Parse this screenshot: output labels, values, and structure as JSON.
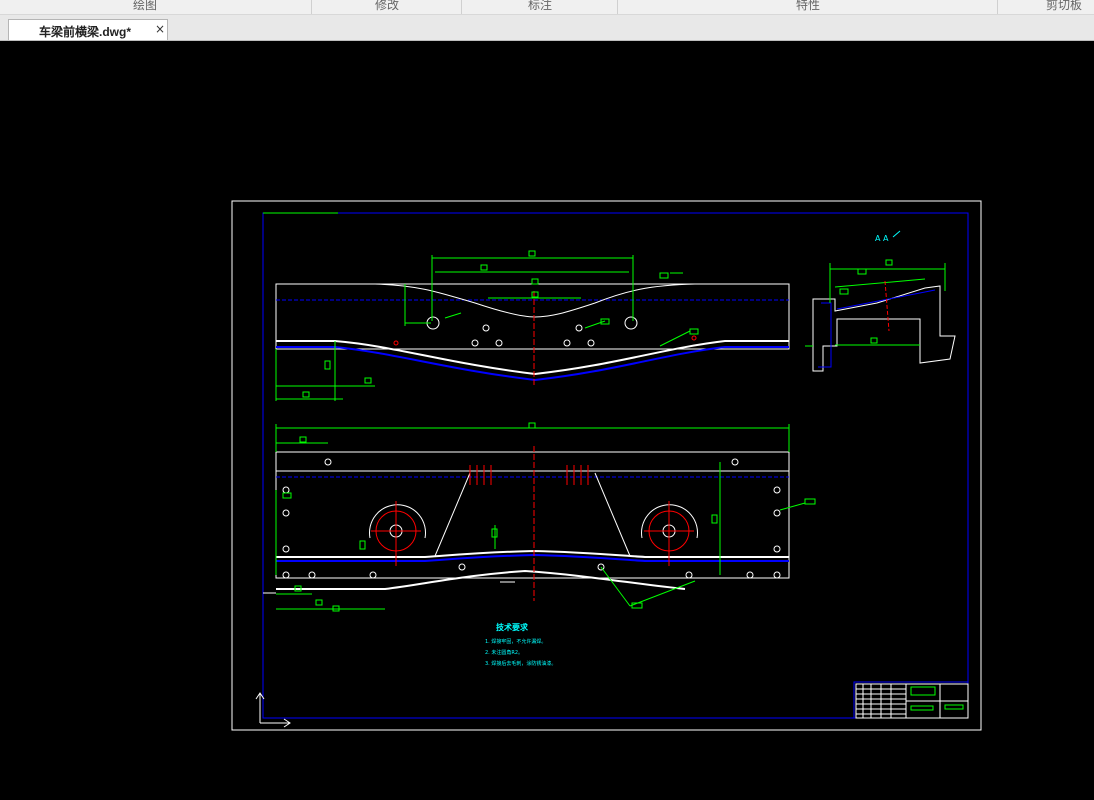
{
  "ribbon": {
    "groups": [
      "绘图",
      "修改",
      "标注",
      "特性",
      "剪切板"
    ]
  },
  "tab": {
    "title": "车梁前横梁.dwg*",
    "close_glyph": "×"
  },
  "colors": {
    "canvas_bg": "#000000",
    "paper_border": "#ffffff",
    "frame": "#0000ff",
    "geometry": "#ffffff",
    "dimension": "#00ff00",
    "centerline": "#ff0000",
    "notes": "#00ffff"
  },
  "drawing": {
    "notes": {
      "heading": "技术要求",
      "items": [
        "1. 焊接牢固，不允许漏焊。",
        "2. 未注圆角R2。",
        "3. 焊接后去毛刺，涂防锈油漆。"
      ]
    }
  }
}
